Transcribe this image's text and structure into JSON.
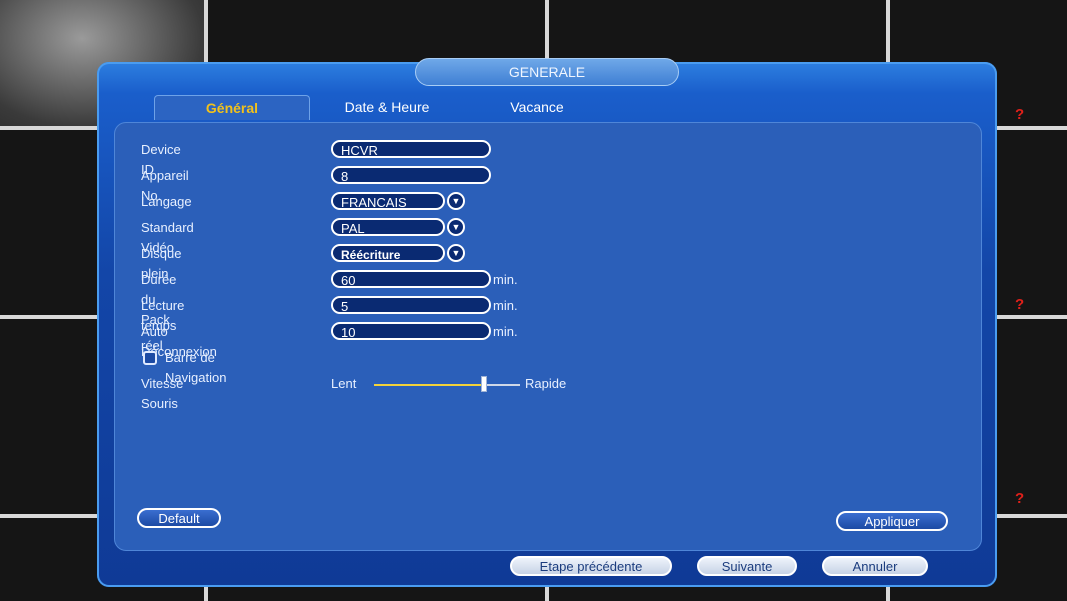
{
  "window": {
    "title": "GENERALE"
  },
  "tabs": [
    {
      "label": "Général",
      "active": true
    },
    {
      "label": "Date & Heure",
      "active": false
    },
    {
      "label": "Vacance",
      "active": false
    }
  ],
  "form": {
    "device_id": {
      "label": "Device ID",
      "value": "HCVR"
    },
    "device_no": {
      "label": "Appareil No.",
      "value": "8"
    },
    "language": {
      "label": "Langage",
      "value": "FRANCAIS"
    },
    "video_standard": {
      "label": "Standard Vidéo",
      "value": "PAL"
    },
    "disk_full": {
      "label": "Disque plein",
      "value": "Réécriture"
    },
    "pack_duration": {
      "label": "Durée du Pack",
      "value": "60",
      "unit": "min."
    },
    "realtime_playback": {
      "label": "Lecture temps réel",
      "value": "5",
      "unit": "min."
    },
    "auto_logout": {
      "label": "Auto Déconnexion",
      "value": "10",
      "unit": "min."
    },
    "nav_bar": {
      "label": "Barre de Navigation",
      "checked": false
    },
    "mouse_speed": {
      "label": "Vitesse Souris",
      "min_label": "Lent",
      "max_label": "Rapide",
      "level": 0.75
    }
  },
  "buttons": {
    "default": "Default",
    "apply": "Appliquer",
    "previous": "Etape précédente",
    "next": "Suivante",
    "cancel": "Annuler"
  },
  "background": {
    "alert_marks": [
      "?",
      "?",
      "?"
    ]
  },
  "colors": {
    "active_tab_text": "#f2c21b",
    "alert": "#e0201a",
    "slider": "#f3d23a"
  }
}
